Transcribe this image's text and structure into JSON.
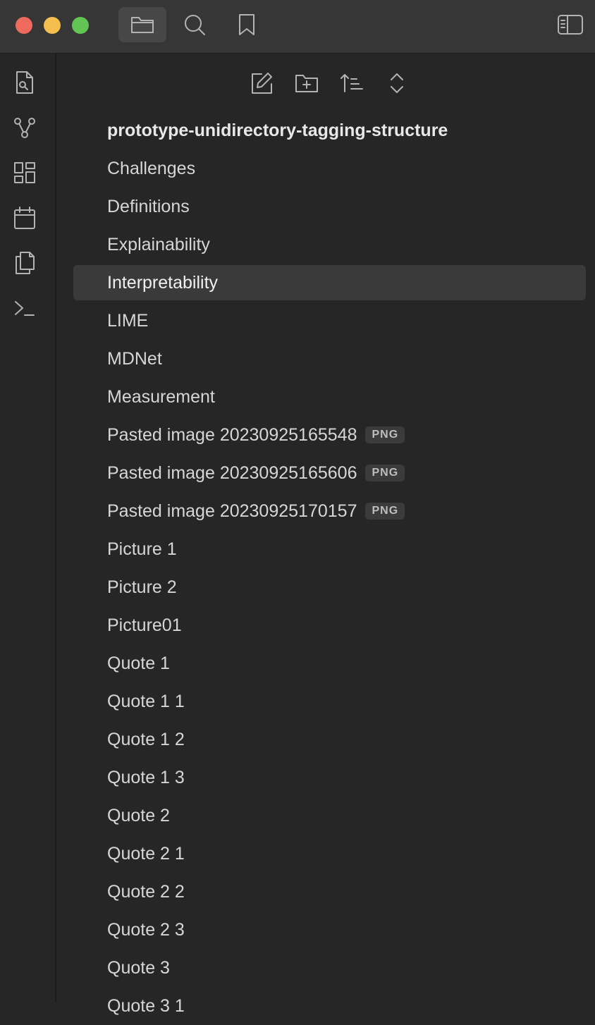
{
  "titlebar": {
    "icons": [
      "folder-icon",
      "search-icon",
      "bookmark-icon",
      "sidebar-toggle-icon"
    ]
  },
  "ribbon": {
    "icons": [
      "file-search-icon",
      "graph-icon",
      "canvas-icon",
      "calendar-icon",
      "copy-icon",
      "terminal-icon"
    ]
  },
  "file_explorer": {
    "actions": [
      "new-note-icon",
      "new-folder-icon",
      "sort-icon",
      "collapse-icon"
    ],
    "root_folder": "prototype-unidirectory-tagging-structure",
    "files": [
      {
        "name": "Challenges",
        "badge": ""
      },
      {
        "name": "Definitions",
        "badge": ""
      },
      {
        "name": "Explainability",
        "badge": ""
      },
      {
        "name": "Interpretability",
        "badge": ""
      },
      {
        "name": "LIME",
        "badge": ""
      },
      {
        "name": "MDNet",
        "badge": ""
      },
      {
        "name": "Measurement",
        "badge": ""
      },
      {
        "name": "Pasted image 20230925165548",
        "badge": "PNG"
      },
      {
        "name": "Pasted image 20230925165606",
        "badge": "PNG"
      },
      {
        "name": "Pasted image 20230925170157",
        "badge": "PNG"
      },
      {
        "name": "Picture 1",
        "badge": ""
      },
      {
        "name": "Picture 2",
        "badge": ""
      },
      {
        "name": "Picture01",
        "badge": ""
      },
      {
        "name": "Quote 1",
        "badge": ""
      },
      {
        "name": "Quote 1 1",
        "badge": ""
      },
      {
        "name": "Quote 1 2",
        "badge": ""
      },
      {
        "name": "Quote 1 3",
        "badge": ""
      },
      {
        "name": "Quote 2",
        "badge": ""
      },
      {
        "name": "Quote 2 1",
        "badge": ""
      },
      {
        "name": "Quote 2 2",
        "badge": ""
      },
      {
        "name": "Quote 2 3",
        "badge": ""
      },
      {
        "name": "Quote 3",
        "badge": ""
      },
      {
        "name": "Quote 3 1",
        "badge": ""
      }
    ],
    "selected": "Interpretability"
  },
  "colors": {
    "background": "#262626",
    "titlebar": "#363636",
    "selected_row": "#3a3a3a"
  }
}
